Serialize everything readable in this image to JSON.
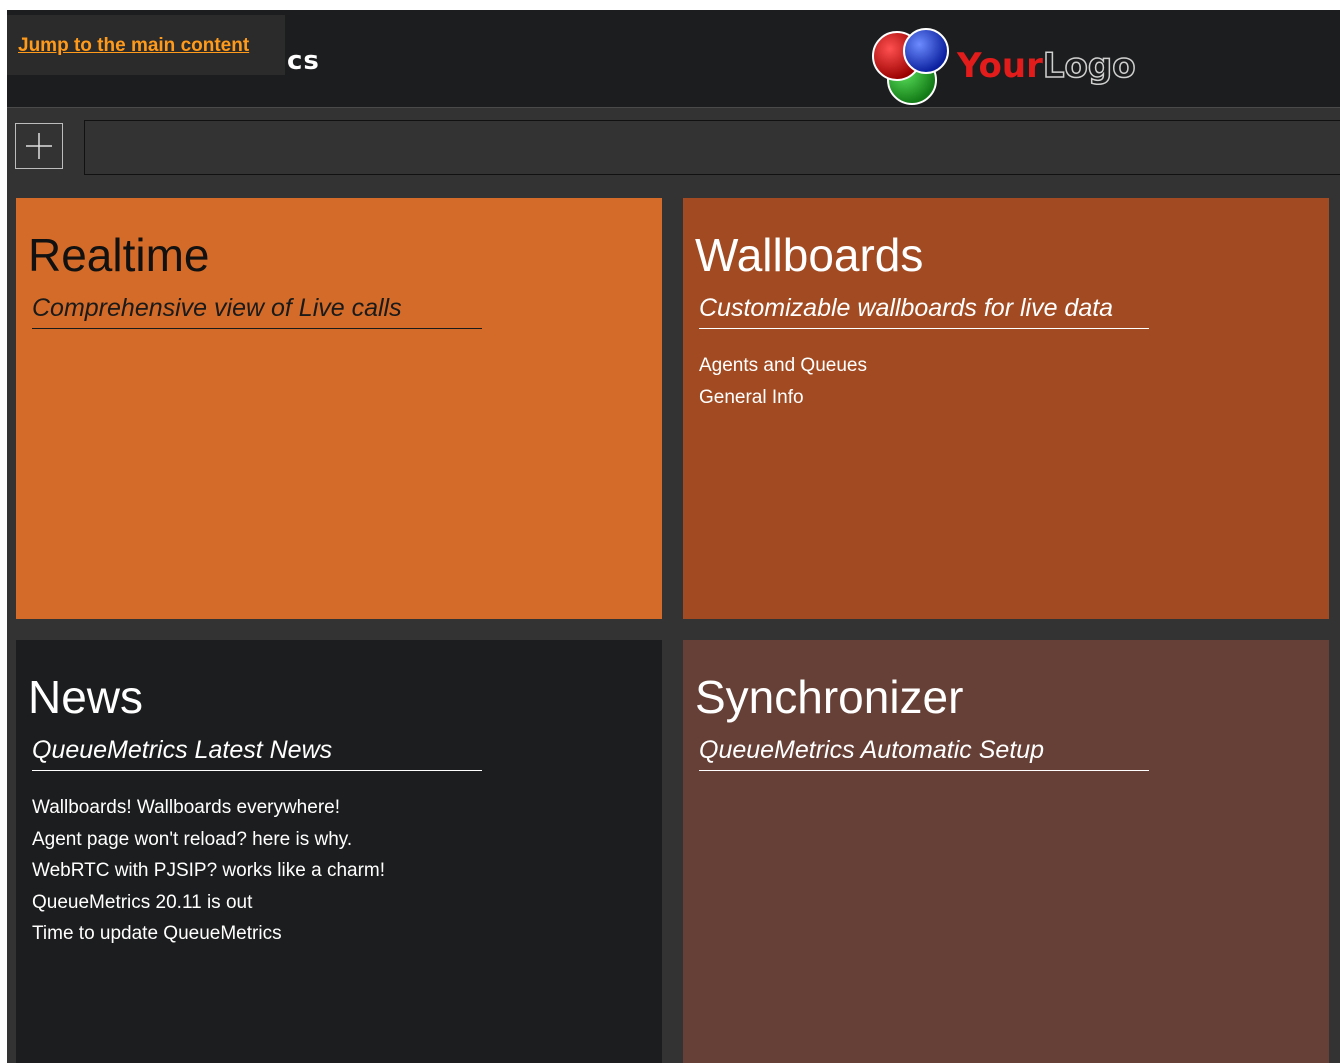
{
  "header": {
    "skip_link": "Jump to the main content",
    "brand_fragment": "cs",
    "logo": {
      "text_part1": "Your",
      "text_part2": "Logo",
      "circle_colors": [
        "#c00000",
        "#22a32b",
        "#1f3fd1"
      ]
    }
  },
  "toolbar": {
    "add_button_icon": "plus-icon",
    "search_value": ""
  },
  "tiles": [
    {
      "title": "Realtime",
      "subtitle": "Comprehensive view of Live calls",
      "color": "#d56b28",
      "items": []
    },
    {
      "title": "Wallboards",
      "subtitle": "Customizable wallboards for live data",
      "color": "#a24b22",
      "items": [
        "Agents and Queues",
        "General Info"
      ]
    },
    {
      "title": "News",
      "subtitle": "QueueMetrics Latest News",
      "color": "#1c1d1e",
      "items": [
        "Wallboards! Wallboards everywhere!",
        "Agent page won't reload? here is why.",
        "WebRTC with PJSIP? works like a charm!",
        "QueueMetrics 20.11 is out",
        "Time to update QueueMetrics"
      ]
    },
    {
      "title": "Synchronizer",
      "subtitle": "QueueMetrics Automatic Setup",
      "color": "#664036",
      "items": []
    }
  ]
}
